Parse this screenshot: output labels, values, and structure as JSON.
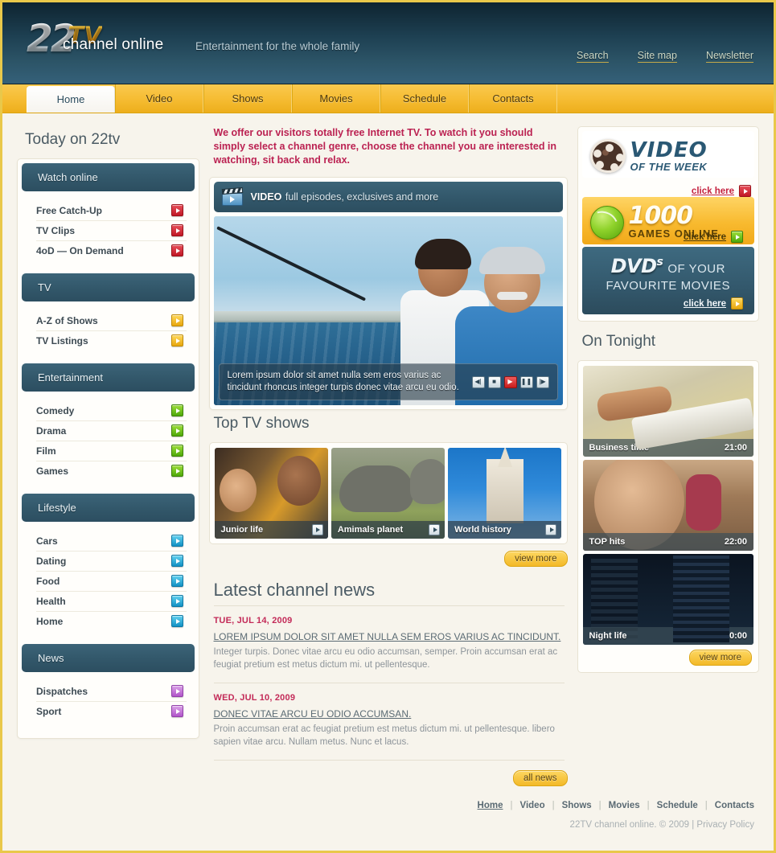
{
  "brand": {
    "logo_num": "22",
    "logo_tv": "TV",
    "logo_sub": "channel online",
    "tagline": "Entertainment for the whole family"
  },
  "header": {
    "links": [
      {
        "label": "Search"
      },
      {
        "label": "Site map"
      },
      {
        "label": "Newsletter"
      }
    ]
  },
  "nav": {
    "tabs": [
      {
        "label": "Home",
        "active": true
      },
      {
        "label": "Video",
        "active": false
      },
      {
        "label": "Shows",
        "active": false
      },
      {
        "label": "Movies",
        "active": false
      },
      {
        "label": "Schedule",
        "active": false
      },
      {
        "label": "Contacts",
        "active": false
      }
    ]
  },
  "sidebar": {
    "title": "Today on 22tv",
    "sections": [
      {
        "heading": "Watch online",
        "arrow_color": "red",
        "items": [
          {
            "label": "Free Catch-Up"
          },
          {
            "label": "TV Clips"
          },
          {
            "label": "4oD — On Demand"
          }
        ]
      },
      {
        "heading": "TV",
        "arrow_color": "yellow",
        "items": [
          {
            "label": "A-Z of Shows"
          },
          {
            "label": "TV Listings"
          }
        ]
      },
      {
        "heading": "Entertainment",
        "arrow_color": "green",
        "items": [
          {
            "label": "Comedy"
          },
          {
            "label": "Drama"
          },
          {
            "label": "Film"
          },
          {
            "label": "Games"
          }
        ]
      },
      {
        "heading": "Lifestyle",
        "arrow_color": "blue",
        "items": [
          {
            "label": "Cars"
          },
          {
            "label": "Dating"
          },
          {
            "label": "Food"
          },
          {
            "label": "Health"
          },
          {
            "label": "Home"
          }
        ]
      },
      {
        "heading": "News",
        "arrow_color": "purple",
        "items": [
          {
            "label": "Dispatches"
          },
          {
            "label": "Sport"
          }
        ]
      }
    ]
  },
  "main": {
    "intro": "We offer our visitors totally free Internet TV. To watch it you should simply select a channel genre, choose the channel you are interested in watching, sit back and relax.",
    "video_panel": {
      "icon": "film-clapper-icon",
      "head_bold": "VIDEO",
      "head_rest": "full episodes, exclusives and more",
      "caption": "Lorem ipsum dolor sit amet nulla sem eros varius ac tincidunt rhoncus integer turpis donec vitae arcu eu odio.",
      "controls": [
        {
          "name": "rewind",
          "glyph": "◀|"
        },
        {
          "name": "stop",
          "glyph": "■"
        },
        {
          "name": "play",
          "glyph": "▶"
        },
        {
          "name": "pause",
          "glyph": "❚❚"
        },
        {
          "name": "forward",
          "glyph": "|▶"
        }
      ]
    },
    "top_shows": {
      "title": "Top TV shows",
      "items": [
        {
          "label": "Junior life"
        },
        {
          "label": "Amimals planet"
        },
        {
          "label": "World history"
        }
      ],
      "view_more": "view more"
    },
    "news": {
      "title": "Latest channel news",
      "all_news": "all news",
      "items": [
        {
          "date": "TUE, JUL 14, 2009",
          "headline": "LOREM IPSUM DOLOR SIT AMET NULLA SEM EROS VARIUS AC TINCIDUNT.",
          "body": "Integer turpis. Donec vitae arcu eu odio accumsan, semper. Proin accumsan erat ac feugiat pretium est metus dictum mi. ut pellentesque."
        },
        {
          "date": "WED, JUL 10, 2009",
          "headline": "DONEC VITAE ARCU EU ODIO ACCUMSAN.",
          "body": "Proin accumsan erat ac feugiat pretium est metus dictum mi. ut pellentesque. libero sapien vitae arcu. Nullam metus. Nunc et lacus."
        }
      ]
    }
  },
  "promos": {
    "video_of_week": {
      "icon": "film-reel-icon",
      "line1": "VIDEO",
      "line2": "OF THE WEEK",
      "cta": "click here",
      "cta_arrow_color": "red"
    },
    "games": {
      "icon": "tennis-ball-icon",
      "line1": "1000",
      "line2": "GAMES ONLINE",
      "cta": "click here",
      "cta_arrow_color": "green"
    },
    "dvds": {
      "line1": "DVD",
      "line1_sup": "s",
      "line1_rest": "OF YOUR",
      "line2": "FAVOURITE MOVIES",
      "cta": "click here",
      "cta_arrow_color": "yellow"
    }
  },
  "tonight": {
    "title": "On Tonight",
    "items": [
      {
        "label": "Business time",
        "time": "21:00"
      },
      {
        "label": "TOP hits",
        "time": "22:00"
      },
      {
        "label": "Night life",
        "time": "00:00"
      }
    ],
    "view_more": "view more"
  },
  "footer": {
    "links": [
      {
        "label": "Home",
        "current": true
      },
      {
        "label": "Video",
        "current": false
      },
      {
        "label": "Shows",
        "current": false
      },
      {
        "label": "Movies",
        "current": false
      },
      {
        "label": "Schedule",
        "current": false
      },
      {
        "label": "Contacts",
        "current": false
      }
    ],
    "separator": "|",
    "copyright": "22TV channel online. © 2009 | Privacy Policy"
  },
  "colors": {
    "nav_yellow": "#f6bd34",
    "panel_head_blue": "#32576a",
    "intro_red": "#bb2252",
    "news_date_red": "#c32a58",
    "border_gold": "#e9c84a"
  }
}
